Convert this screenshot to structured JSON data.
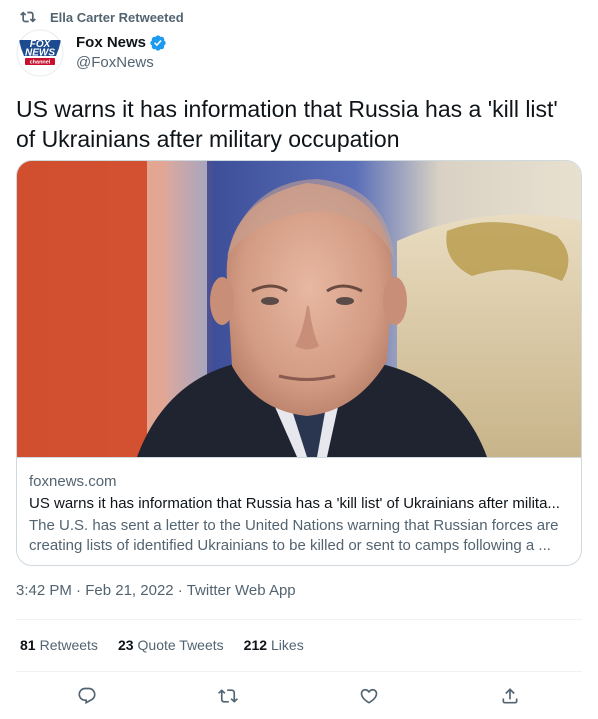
{
  "retweet_context": {
    "label": "Ella Carter Retweeted"
  },
  "author": {
    "name": "Fox News",
    "handle": "@FoxNews",
    "avatar_text_top": "FOX",
    "avatar_text_mid": "NEWS",
    "avatar_text_bottom": "channel"
  },
  "tweet": {
    "text": "US warns it has information that Russia has a 'kill list' of Ukrainians after military occupation"
  },
  "card": {
    "domain": "foxnews.com",
    "title": "US warns it has information that Russia has a 'kill list' of Ukrainians after milita...",
    "description": "The U.S. has sent a letter to the United Nations warning that Russian forces are creating lists of identified Ukrainians to be killed or sent to camps following a ..."
  },
  "meta": {
    "time": "3:42 PM",
    "date": "Feb 21, 2022",
    "source": "Twitter Web App",
    "separator": "·"
  },
  "stats": {
    "retweets_count": "81",
    "retweets_label": "Retweets",
    "quotes_count": "23",
    "quotes_label": "Quote Tweets",
    "likes_count": "212",
    "likes_label": "Likes"
  },
  "colors": {
    "text": "#0f1419",
    "secondary": "#536471",
    "border": "#cfd9de",
    "verified": "#1d9bf0",
    "brand_red": "#c8102e",
    "brand_blue": "#1d4b8f"
  },
  "icons": [
    "retweet-icon",
    "verified-badge-icon",
    "reply-icon",
    "retweet-icon",
    "like-icon",
    "share-icon"
  ]
}
